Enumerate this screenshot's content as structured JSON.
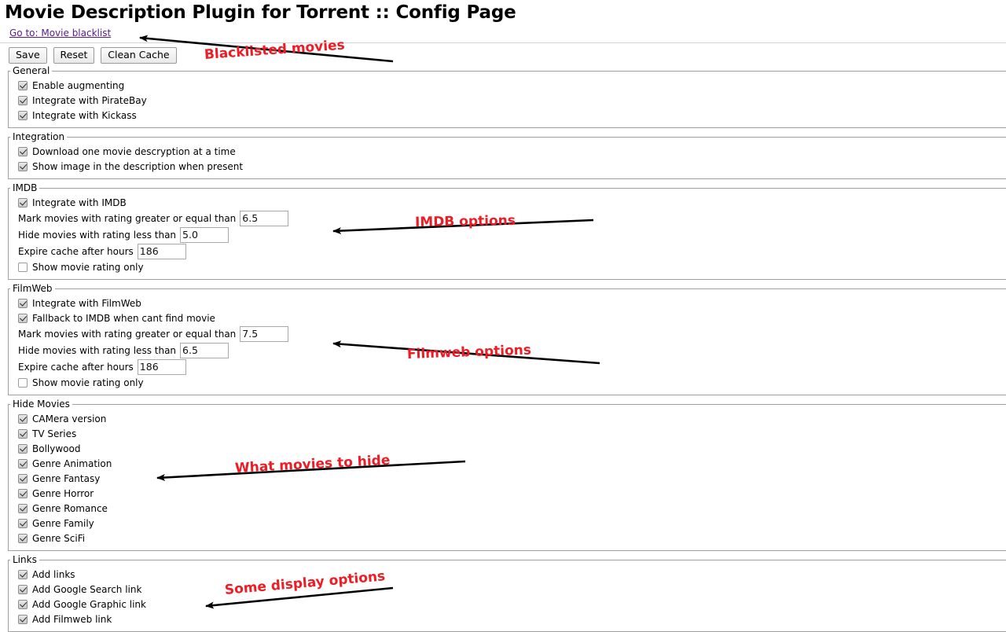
{
  "page": {
    "title": "Movie Description Plugin for Torrent :: Config Page",
    "goto_link": "Go to: Movie blacklist"
  },
  "toolbar": {
    "save_label": "Save",
    "reset_label": "Reset",
    "clean_cache_label": "Clean Cache"
  },
  "sections": {
    "general": {
      "legend": "General",
      "items": [
        {
          "label": "Enable augmenting",
          "checked": true
        },
        {
          "label": "Integrate with PirateBay",
          "checked": true
        },
        {
          "label": "Integrate with Kickass",
          "checked": true
        }
      ]
    },
    "integration": {
      "legend": "Integration",
      "items": [
        {
          "label": "Download one movie descryption at a time",
          "checked": true
        },
        {
          "label": "Show image in the description when present",
          "checked": true
        }
      ]
    },
    "imdb": {
      "legend": "IMDB",
      "integrate_label": "Integrate with IMDB",
      "integrate_checked": true,
      "mark_label": "Mark movies with rating greater or equal than",
      "mark_value": "6.5",
      "hide_label": "Hide movies with rating less than",
      "hide_value": "5.0",
      "expire_label": "Expire cache after hours",
      "expire_value": "186",
      "rating_only_label": "Show movie rating only",
      "rating_only_checked": false
    },
    "filmweb": {
      "legend": "FilmWeb",
      "integrate_label": "Integrate with FilmWeb",
      "integrate_checked": true,
      "fallback_label": "Fallback to IMDB when cant find movie",
      "fallback_checked": true,
      "mark_label": "Mark movies with rating greater or equal than",
      "mark_value": "7.5",
      "hide_label": "Hide movies with rating less than",
      "hide_value": "6.5",
      "expire_label": "Expire cache after hours",
      "expire_value": "186",
      "rating_only_label": "Show movie rating only",
      "rating_only_checked": false
    },
    "hide_movies": {
      "legend": "Hide Movies",
      "items": [
        {
          "label": "CAMera version",
          "checked": true
        },
        {
          "label": "TV Series",
          "checked": true
        },
        {
          "label": "Bollywood",
          "checked": true
        },
        {
          "label": "Genre Animation",
          "checked": true
        },
        {
          "label": "Genre Fantasy",
          "checked": true
        },
        {
          "label": "Genre Horror",
          "checked": true
        },
        {
          "label": "Genre Romance",
          "checked": true
        },
        {
          "label": "Genre Family",
          "checked": true
        },
        {
          "label": "Genre SciFi",
          "checked": true
        }
      ]
    },
    "links": {
      "legend": "Links",
      "items": [
        {
          "label": "Add links",
          "checked": true
        },
        {
          "label": "Add Google Search link",
          "checked": true
        },
        {
          "label": "Add Google Graphic link",
          "checked": true
        },
        {
          "label": "Add Filmweb link",
          "checked": true
        }
      ]
    }
  },
  "annotations": [
    {
      "text": "Blacklisted movies",
      "color": "#ee1c24"
    },
    {
      "text": "IMDB options",
      "color": "#ee1c24"
    },
    {
      "text": "Filmweb options",
      "color": "#ee1c24"
    },
    {
      "text": "What movies to hide",
      "color": "#ee1c24"
    },
    {
      "text": "Some display options",
      "color": "#ee1c24"
    }
  ]
}
